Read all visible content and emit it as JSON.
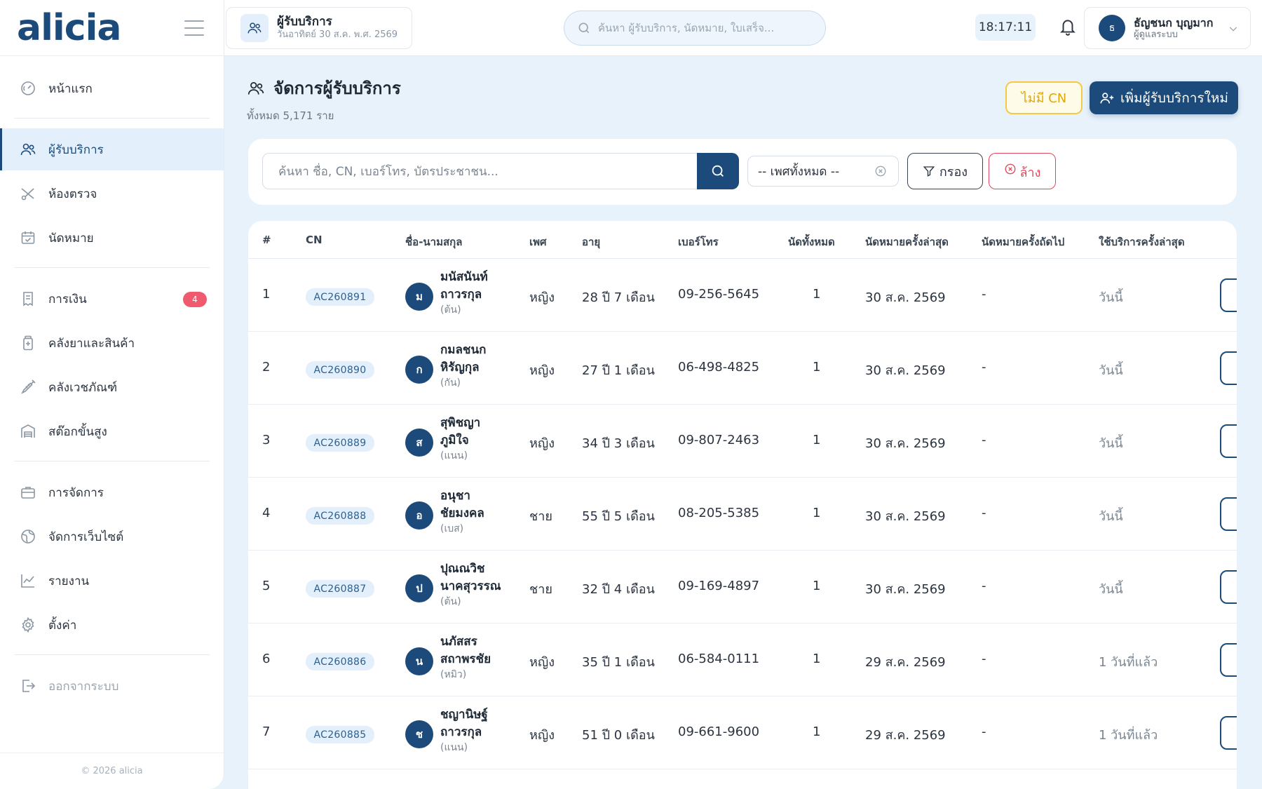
{
  "brand": {
    "logo": "alicia"
  },
  "sidebar": {
    "items": [
      {
        "label": "หน้าแรก",
        "icon": "dashboard-gauge-icon"
      },
      {
        "label": "ผู้รับบริการ",
        "icon": "users-icon",
        "active": true
      },
      {
        "label": "ห้องตรวจ",
        "icon": "scissors-icon"
      },
      {
        "label": "นัดหมาย",
        "icon": "calendar-check-icon"
      },
      {
        "label": "การเงิน",
        "icon": "receipt-icon",
        "badge": "4"
      },
      {
        "label": "คลังยาและสินค้า",
        "icon": "medicine-bottle-icon"
      },
      {
        "label": "คลังเวชภัณฑ์",
        "icon": "syringe-icon"
      },
      {
        "label": "สต๊อกขั้นสูง",
        "icon": "warehouse-icon"
      },
      {
        "label": "การจัดการ",
        "icon": "briefcase-icon"
      },
      {
        "label": "จัดการเว็บไซต์",
        "icon": "globe-icon"
      },
      {
        "label": "รายงาน",
        "icon": "chart-line-icon"
      },
      {
        "label": "ตั้งค่า",
        "icon": "gear-icon"
      },
      {
        "label": "ออกจากระบบ",
        "icon": "logout-icon"
      }
    ],
    "footer": "© 2026 alicia"
  },
  "topbar": {
    "page_chip_title": "ผู้รับบริการ",
    "page_chip_date": "วันอาทิตย์ 30 ส.ค. พ.ศ. 2569",
    "search_placeholder": "ค้นหา ผู้รับบริการ, นัดหมาย, ใบเสร็จ...",
    "clock": "18:17:11",
    "user_initial": "ธ",
    "user_name": "ธัญชนก บุญมาก",
    "user_role": "ผู้ดูแลระบบ"
  },
  "page": {
    "title": "จัดการผู้รับบริการ",
    "count": "ทั้งหมด 5,171 ราย",
    "no_cn_button": "ไม่มี CN",
    "add_button": "เพิ่มผู้รับบริการใหม่"
  },
  "filters": {
    "search_placeholder": "ค้นหา ชื่อ, CN, เบอร์โทร, บัตรประชาชน...",
    "gender_select": "-- เพศทั้งหมด --",
    "filter_button": "กรอง",
    "clear_button": "ล้าง"
  },
  "table": {
    "headers": [
      "#",
      "CN",
      "ชื่อ-นามสกุล",
      "เพศ",
      "อายุ",
      "เบอร์โทร",
      "นัดทั้งหมด",
      "นัดหมายครั้งล่าสุด",
      "นัดหมายครั้งถัดไป",
      "ใช้บริการครั้งล่าสุด"
    ],
    "rows": [
      {
        "no": "1",
        "cn": "AC260891",
        "initial": "ม",
        "first": "มนัสนันท์",
        "last": "ถาวรกุล",
        "nick": "(ต้น)",
        "gender": "หญิง",
        "age": "28 ปี 7 เดือน",
        "phone": "09-256-5645",
        "total": "1",
        "last_appt": "30 ส.ค. 2569",
        "next_appt": "-",
        "last_service": "วันนี้"
      },
      {
        "no": "2",
        "cn": "AC260890",
        "initial": "ก",
        "first": "กมลชนก",
        "last": "หิรัญกุล",
        "nick": "(กัน)",
        "gender": "หญิง",
        "age": "27 ปี 1 เดือน",
        "phone": "06-498-4825",
        "total": "1",
        "last_appt": "30 ส.ค. 2569",
        "next_appt": "-",
        "last_service": "วันนี้"
      },
      {
        "no": "3",
        "cn": "AC260889",
        "initial": "ส",
        "first": "สุพิชญา",
        "last": "ภูมิใจ",
        "nick": "(แนน)",
        "gender": "หญิง",
        "age": "34 ปี 3 เดือน",
        "phone": "09-807-2463",
        "total": "1",
        "last_appt": "30 ส.ค. 2569",
        "next_appt": "-",
        "last_service": "วันนี้"
      },
      {
        "no": "4",
        "cn": "AC260888",
        "initial": "อ",
        "first": "อนุชา",
        "last": "ชัยมงคล",
        "nick": "(เบส)",
        "gender": "ชาย",
        "age": "55 ปี 5 เดือน",
        "phone": "08-205-5385",
        "total": "1",
        "last_appt": "30 ส.ค. 2569",
        "next_appt": "-",
        "last_service": "วันนี้"
      },
      {
        "no": "5",
        "cn": "AC260887",
        "initial": "ป",
        "first": "ปุณณวิช",
        "last": "นาคสุวรรณ",
        "nick": "(ต้น)",
        "gender": "ชาย",
        "age": "32 ปี 4 เดือน",
        "phone": "09-169-4897",
        "total": "1",
        "last_appt": "30 ส.ค. 2569",
        "next_appt": "-",
        "last_service": "วันนี้"
      },
      {
        "no": "6",
        "cn": "AC260886",
        "initial": "น",
        "first": "นภัสสร",
        "last": "สถาพรชัย",
        "nick": "(หมิว)",
        "gender": "หญิง",
        "age": "35 ปี 1 เดือน",
        "phone": "06-584-0111",
        "total": "1",
        "last_appt": "29 ส.ค. 2569",
        "next_appt": "-",
        "last_service": "1 วันที่แล้ว"
      },
      {
        "no": "7",
        "cn": "AC260885",
        "initial": "ช",
        "first": "ชญานิษฐ์",
        "last": "ถาวรกุล",
        "nick": "(แนน)",
        "gender": "หญิง",
        "age": "51 ปี 0 เดือน",
        "phone": "09-661-9600",
        "total": "1",
        "last_appt": "29 ส.ค. 2569",
        "next_appt": "-",
        "last_service": "1 วันที่แล้ว"
      }
    ]
  },
  "colors": {
    "brand": "#1c4a7a",
    "accent_bg": "#e3f0fb",
    "warning": "#f6c944",
    "danger": "#e0475c",
    "badge": "#ef5a6f"
  }
}
